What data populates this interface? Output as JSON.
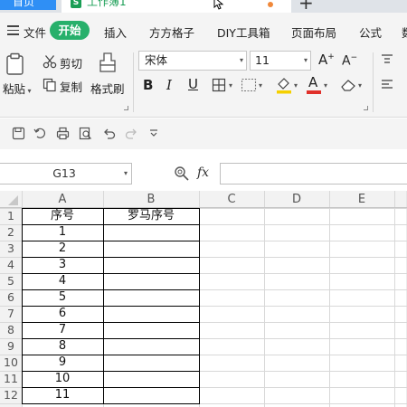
{
  "tabs": {
    "home_label": "首页",
    "doc_label": "工作簿1",
    "new_tab": "+"
  },
  "menu": {
    "items": [
      "文件",
      "开始",
      "插入",
      "方方格子",
      "DIY工具箱",
      "页面布局",
      "公式",
      "数"
    ]
  },
  "ribbon": {
    "paste_label": "粘贴",
    "cut_label": "剪切",
    "copy_label": "复制",
    "format_painter_label": "格式刷",
    "font_name": "宋体",
    "font_size": "11",
    "bold": "B",
    "italic": "I",
    "underline": "U"
  },
  "formula_bar": {
    "name_box": "G13",
    "fx": "fx",
    "formula": ""
  },
  "sheet": {
    "columns": [
      "A",
      "B",
      "C",
      "D",
      "E"
    ],
    "row_numbers": [
      "1",
      "2",
      "3",
      "4",
      "5",
      "6",
      "7",
      "8",
      "9",
      "10",
      "11",
      "12"
    ],
    "col_a": [
      "序号",
      "1",
      "2",
      "3",
      "4",
      "5",
      "6",
      "7",
      "8",
      "9",
      "10",
      "11"
    ],
    "col_b": [
      "罗马序号",
      "",
      "",
      "",
      "",
      "",
      "",
      "",
      "",
      "",
      "",
      ""
    ]
  },
  "colors": {
    "accent_green": "#27b06b",
    "home_tab_blue": "#2f8ff5",
    "font_color_red": "#e0302a",
    "highlight_yellow": "#f5d000"
  }
}
